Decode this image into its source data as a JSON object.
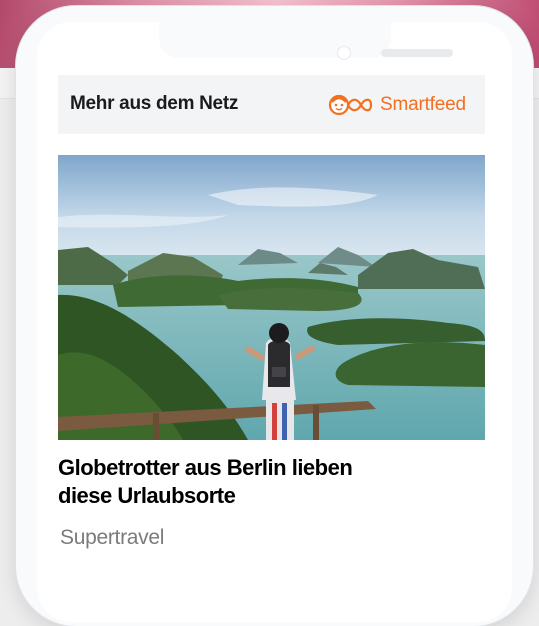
{
  "widget": {
    "heading": "Mehr aus dem Netz",
    "brand_name": "Smartfeed",
    "brand_icon": "smartfeed-logo-icon",
    "brand_color": "#f36f21"
  },
  "article": {
    "title_line1": "Globetrotter aus Berlin lieben",
    "title_line2": "diese Urlaubsorte",
    "source": "Supertravel",
    "image": "traveler-with-backpack-overlooking-tropical-islands"
  },
  "colors": {
    "header_background": "#f3f4f6",
    "source_text": "#7b7b7b"
  }
}
